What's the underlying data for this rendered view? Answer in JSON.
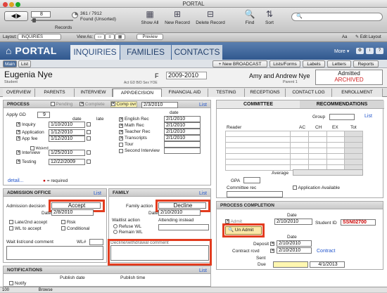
{
  "window": {
    "title": "PORTAL"
  },
  "toolbar": {
    "record_num": "8",
    "records_label": "Records",
    "found_count": "361 / 7912",
    "found_status": "Found (Unsorted)",
    "show_all": "Show All",
    "new_record": "New Record",
    "delete_record": "Delete Record",
    "find": "Find",
    "sort": "Sort",
    "search_placeholder": ""
  },
  "fmbar": {
    "layout_label": "Layout:",
    "layout_value": "INQUIRIES",
    "view_label": "View As:",
    "preview": "Preview",
    "aa": "Aa",
    "edit_layout": "Edit Layout"
  },
  "header": {
    "brand": "PORTAL",
    "tabs": [
      "INQUIRIES",
      "FAMILIES",
      "CONTACTS"
    ],
    "more": "More"
  },
  "subbar": {
    "main": "Main",
    "list": "List",
    "new_broadcast": "New BROADCAST",
    "lists_forms": "Lists/Forms",
    "labels": "Labels",
    "letters": "Letters",
    "reports": "Reports"
  },
  "record": {
    "name": "Eugenia Nye",
    "name_sub": "Student",
    "gender": "F",
    "year": "2009-2010",
    "sub_labels": "Act GD  B/D  Sex  YOE",
    "parents": "Amy and Andrew Nye",
    "parent_sub": "Parent 1",
    "status1": "Admitted",
    "status2": "ARCHIVED"
  },
  "tabs": [
    "OVERVIEW",
    "PARENTS",
    "INTERVIEW",
    "APP/DECISION",
    "FINANCIAL AID",
    "TESTING",
    "RECEPTIONS",
    "CONTACT LOG",
    "ENROLLMENT"
  ],
  "process": {
    "title": "PROCESS",
    "pending": "Pending",
    "complete": "Complete",
    "comp_ovr": "Comp ovr",
    "comp_date": "2/3/2010",
    "list": "List",
    "apply_gd_label": "Apply GD",
    "apply_gd": "9",
    "date_hdr": "date",
    "late_hdr": "late",
    "rows": [
      {
        "label": "Inquiry",
        "date": "1/10/2010"
      },
      {
        "label": "Application",
        "date": "1/12/2010"
      },
      {
        "label": "App fee",
        "date": "1/12/2010"
      },
      {
        "label": "Interview",
        "date": "1/25/2010"
      },
      {
        "label": "Testing",
        "date": "12/22/2009"
      }
    ],
    "waived": "Waived",
    "recs": [
      {
        "label": "English Rec",
        "date": "2/1/2010"
      },
      {
        "label": "Math Rec",
        "date": "2/1/2010"
      },
      {
        "label": "Teacher Rec",
        "date": "2/1/2010"
      },
      {
        "label": "Transcripts",
        "date": "2/1/2010"
      },
      {
        "label": "Tour",
        "date": ""
      },
      {
        "label": "Second Interview",
        "date": ""
      }
    ],
    "detail": "detail...",
    "required": "= required"
  },
  "committee": {
    "title": "COMMITTEE",
    "recommendations": "RECOMMENDATIONS",
    "group": "Group",
    "list": "List",
    "reader": "Reader",
    "cols": [
      "AC",
      "CH",
      "EX",
      "Tot"
    ],
    "average": "Average",
    "gpa": "GPA",
    "committee_rec": "Committee rec",
    "app_available": "Application Available"
  },
  "admission": {
    "title": "ADMISSION OFFICE",
    "list": "List",
    "decision_label": "Admission decision",
    "decision": "Accept",
    "date_label": "Date",
    "date": "2/8/2010",
    "late_admit": "Late/2nd accept",
    "risk": "Risk",
    "wl_accept": "WL to accept",
    "conditional": "Conditional",
    "waitlist_label": "Wait list/cond comment",
    "wl_num": "WL#"
  },
  "family": {
    "title": "FAMILY",
    "list": "List",
    "action_label": "Family action",
    "action": "Decline",
    "date_label": "Date",
    "date": "2/10/2010",
    "waitlist_action": "Waitlist action",
    "refuse_wl": "Refuse WL",
    "remain_wl": "Remain WL",
    "attending_label": "Attending instead",
    "decline_comment": "Decline/withdrawal comment"
  },
  "completion": {
    "title": "PROCESS COMPLETION",
    "date_hdr": "Date",
    "admit": "Admit",
    "admit_date": "2/10/2010",
    "unadmit": "Un Admit",
    "student_id_label": "Student ID",
    "student_id": "SSN02700",
    "date_hdr2": "Date",
    "deposit": "Deposit",
    "deposit_date": "2/10/2010",
    "contract": "Contract rcvd",
    "contract_date": "2/10/2010",
    "contract_link": "Contract",
    "sent": "Sent",
    "due": "Due",
    "due_date": "4/1/2013"
  },
  "notifications": {
    "title": "NOTIFICATIONS",
    "list": "List",
    "publish_date": "Publish date",
    "publish_time": "Publish time",
    "notify": "Notify"
  },
  "statusbar": {
    "zoom": "100",
    "mode": "Browse"
  }
}
